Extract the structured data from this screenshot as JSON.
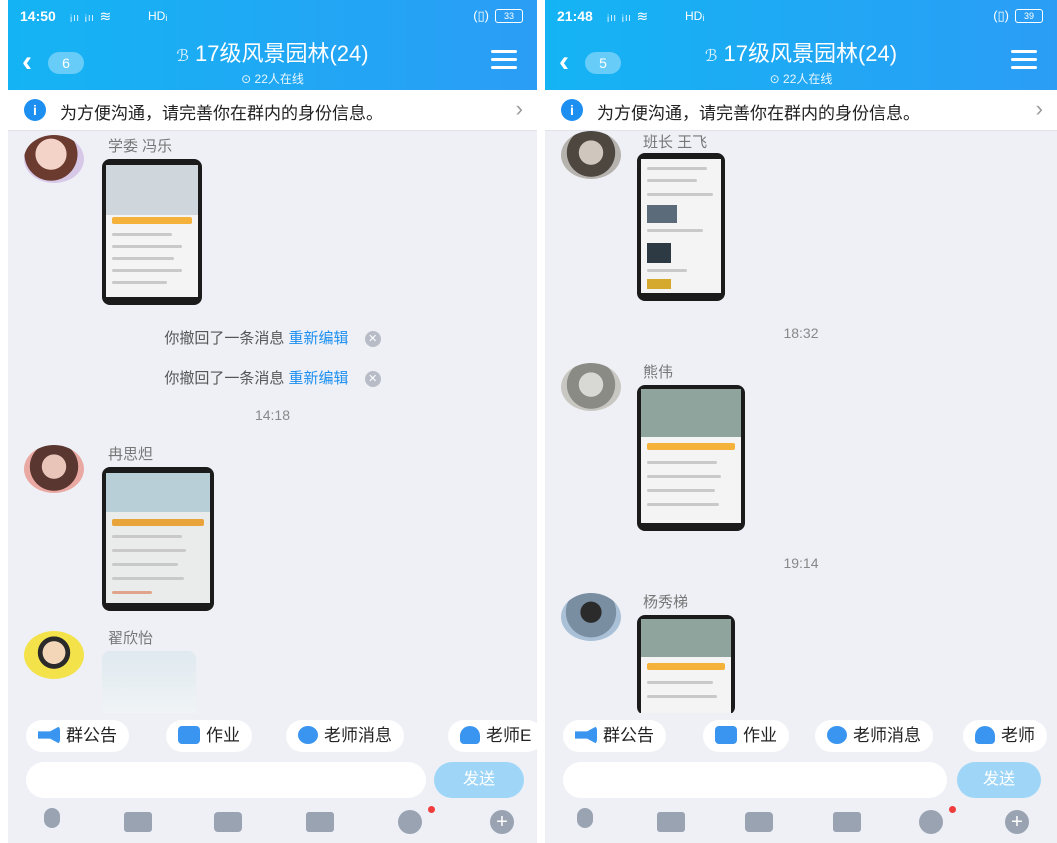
{
  "panels": [
    {
      "status": {
        "time": "14:50",
        "signal": "ᵢₗₗ ᵢₗₗ ≋",
        "network": "HDᵢ",
        "battery": "33"
      },
      "header": {
        "unread_count": "6",
        "group_title": "17级风景园林(24)",
        "online": "22人在线"
      },
      "notice": {
        "text": "为方便沟通，请完善你在群内的身份信息。"
      },
      "chat": {
        "sender_1": "学委 冯乐",
        "recall_1": "你撤回了一条消息",
        "reedit_1": "重新编辑",
        "recall_2": "你撤回了一条消息",
        "reedit_2": "重新编辑",
        "time_1": "14:18",
        "sender_2": "冉思炟",
        "sender_3": "翟欣怡"
      },
      "chips": {
        "announce": "群公告",
        "homework": "作业",
        "teacher_msg": "老师消息",
        "teacher_other": "老师E"
      },
      "input": {
        "send": "发送"
      }
    },
    {
      "status": {
        "time": "21:48",
        "signal": "ᵢₗₗ ᵢₗₗ ≋",
        "network": "HDᵢ",
        "battery": "39"
      },
      "header": {
        "unread_count": "5",
        "group_title": "17级风景园林(24)",
        "online": "22人在线"
      },
      "notice": {
        "text": "为方便沟通，请完善你在群内的身份信息。"
      },
      "chat": {
        "sender_1": "班长 王飞",
        "time_1": "18:32",
        "sender_2": "熊伟",
        "time_2": "19:14",
        "sender_3": "杨秀梯"
      },
      "chips": {
        "announce": "群公告",
        "homework": "作业",
        "teacher_msg": "老师消息",
        "teacher_other": "老师"
      },
      "input": {
        "send": "发送"
      }
    }
  ],
  "colors": {
    "header_start": "#14b4f4",
    "header_end": "#2b9df5",
    "link": "#1d8ff0",
    "chat_bg": "#eef0f6"
  }
}
